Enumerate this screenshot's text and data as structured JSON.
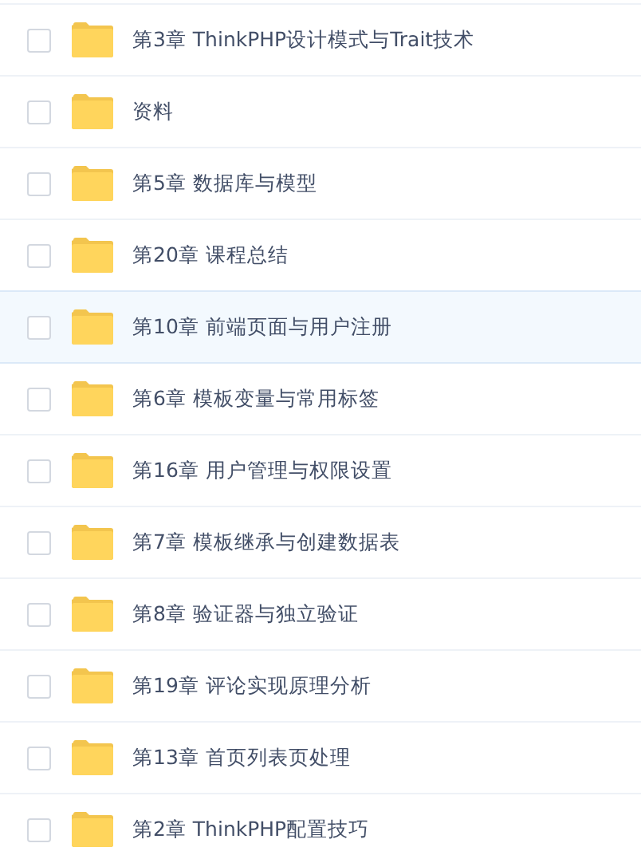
{
  "files": [
    {
      "name": "第3章 ThinkPHP设计模式与Trait技术",
      "checked": false,
      "selected": false
    },
    {
      "name": "资料",
      "checked": false,
      "selected": false
    },
    {
      "name": "第5章 数据库与模型",
      "checked": false,
      "selected": false
    },
    {
      "name": "第20章 课程总结",
      "checked": false,
      "selected": false
    },
    {
      "name": "第10章 前端页面与用户注册",
      "checked": false,
      "selected": true
    },
    {
      "name": "第6章 模板变量与常用标签",
      "checked": false,
      "selected": false
    },
    {
      "name": "第16章 用户管理与权限设置",
      "checked": false,
      "selected": false
    },
    {
      "name": "第7章 模板继承与创建数据表",
      "checked": false,
      "selected": false
    },
    {
      "name": "第8章 验证器与独立验证",
      "checked": false,
      "selected": false
    },
    {
      "name": "第19章 评论实现原理分析",
      "checked": false,
      "selected": false
    },
    {
      "name": "第13章 首页列表页处理",
      "checked": false,
      "selected": false
    },
    {
      "name": "第2章 ThinkPHP配置技巧",
      "checked": false,
      "selected": false
    }
  ]
}
